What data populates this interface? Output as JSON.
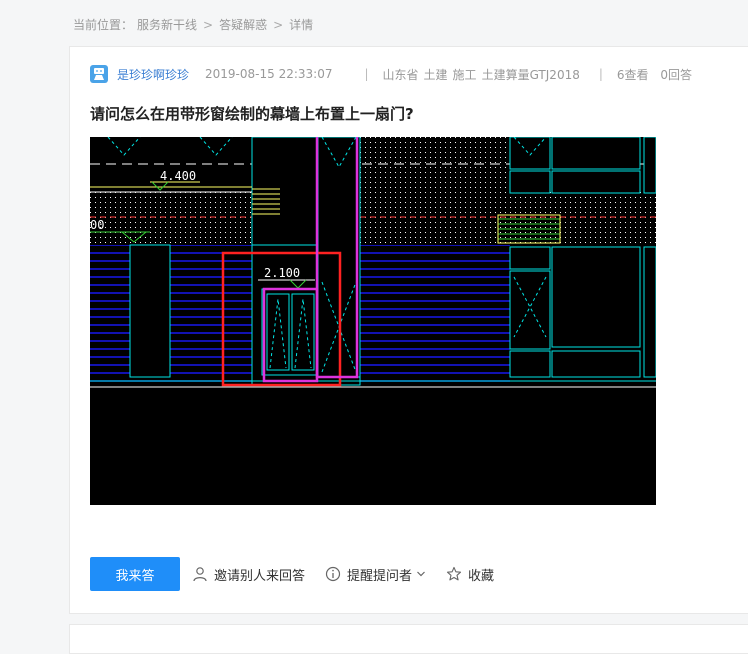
{
  "breadcrumb": {
    "label": "当前位置：",
    "items": [
      "服务新干线",
      "答疑解惑",
      "详情"
    ],
    "separator": ">"
  },
  "question": {
    "author": "是珍珍啊珍珍",
    "timestamp": "2019-08-15 22:33:07",
    "tags": [
      "山东省",
      "土建",
      "施工",
      "土建算量GTJ2018"
    ],
    "views": "6查看",
    "answers": "0回答",
    "title": "请问怎么在用带形窗绘制的幕墙上布置上一扇门?"
  },
  "drawing": {
    "labels": [
      "4.400",
      "00",
      "2.100"
    ],
    "colors": {
      "background": "#000000",
      "cyan": "#00e5e5",
      "blue": "#1a1aff",
      "yellow": "#ffff66",
      "green": "#33cc33",
      "red_annotation": "#ff2222",
      "magenta_annotation": "#dd33dd",
      "white": "#ffffff"
    }
  },
  "actions": {
    "answer_button": "我来答",
    "invite": "邀请别人来回答",
    "remind": "提醒提问者",
    "favorite": "收藏"
  },
  "colors": {
    "accent": "#1f8ef9",
    "author": "#3c7fd3"
  }
}
